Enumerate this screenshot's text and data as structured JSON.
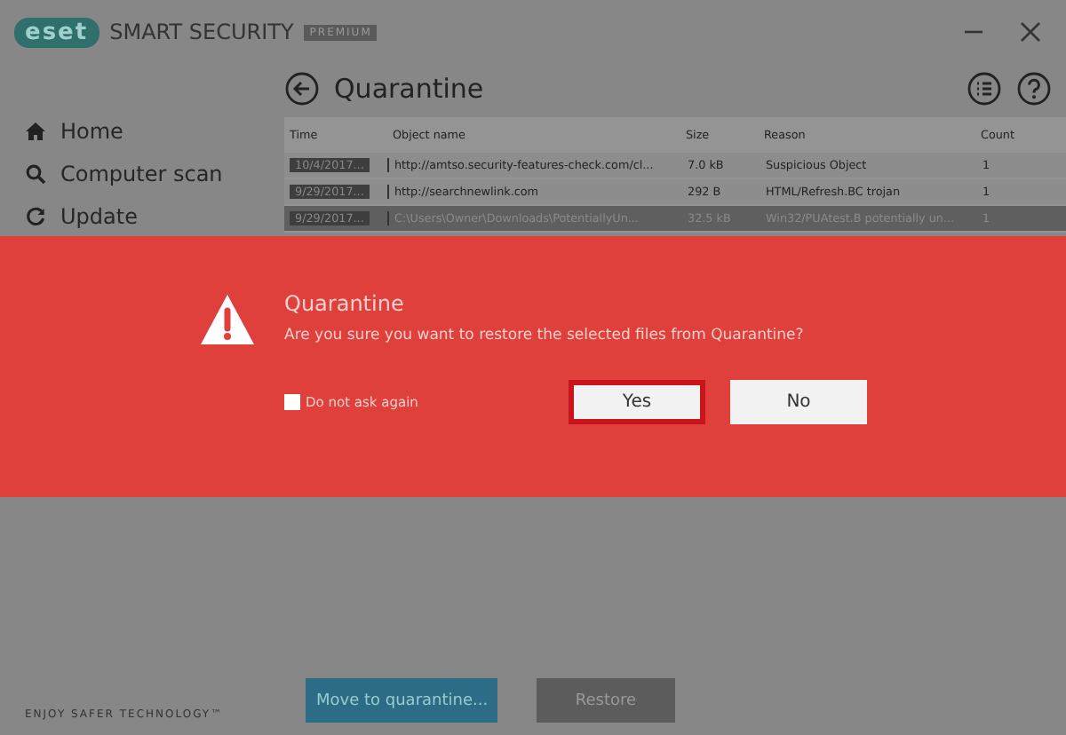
{
  "app": {
    "logo": "eset",
    "title": "SMART SECURITY",
    "edition": "PREMIUM"
  },
  "sidebar": {
    "items": [
      {
        "label": "Home",
        "selected": false
      },
      {
        "label": "Computer scan",
        "selected": false
      },
      {
        "label": "Update",
        "selected": false
      }
    ],
    "footer": "ENJOY SAFER TECHNOLOGY™"
  },
  "page": {
    "title": "Quarantine"
  },
  "table": {
    "columns": [
      "Time",
      "Object name",
      "Size",
      "Reason",
      "Count"
    ],
    "rows": [
      {
        "cells": [
          "10/4/2017...",
          "http://amtso.security-features-check.com/cl...",
          "7.0 kB",
          "Suspicious Object",
          "1"
        ],
        "selected": false
      },
      {
        "cells": [
          "9/29/2017...",
          "http://searchnewlink.com",
          "292 B",
          "HTML/Refresh.BC trojan",
          "1"
        ],
        "selected": false
      },
      {
        "cells": [
          "9/29/2017...",
          "C:\\Users\\Owner\\Downloads\\PotentiallyUn...",
          "32.5 kB",
          "Win32/PUAtest.B potentially un...",
          "1"
        ],
        "selected": true
      }
    ]
  },
  "actions": [
    {
      "label": "Move to quarantine...",
      "kind": "primary"
    },
    {
      "label": "Restore",
      "kind": "secondary"
    }
  ],
  "dialog": {
    "title": "Quarantine",
    "message": "Are you sure you want to restore the selected files from Quarantine?",
    "checkbox": {
      "label": "Do not ask again",
      "checked": false
    },
    "buttons": [
      {
        "label": "Yes",
        "selected": true
      },
      {
        "label": "No",
        "selected": false
      }
    ]
  }
}
